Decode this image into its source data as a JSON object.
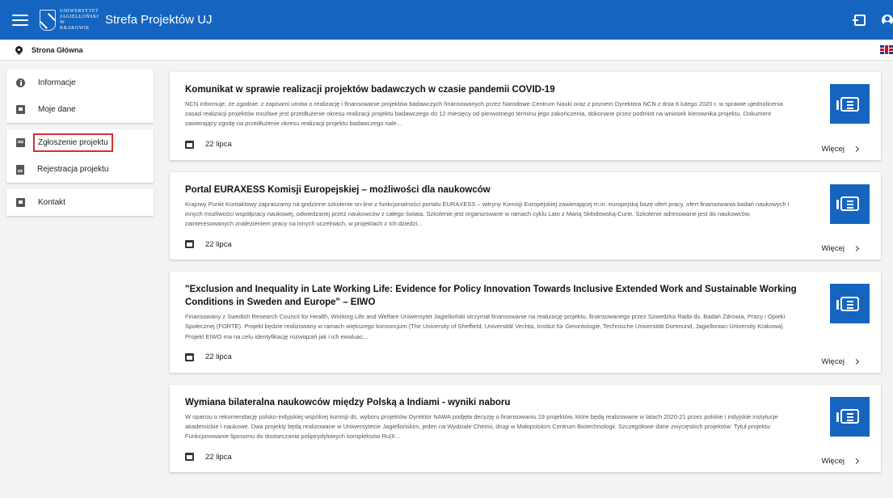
{
  "header": {
    "app_title": "Strefa Projektów UJ",
    "logo_text": "Uniwersytet Jagielloński w Krakowie",
    "brand_color": "#1565c0",
    "icons": [
      "menu-icon",
      "login-icon",
      "account-icon"
    ]
  },
  "breadcrumb": {
    "current": "Strona Główna",
    "language_flag": "uk-flag-icon"
  },
  "sidebar": {
    "groups": [
      [
        {
          "label": "Informacje",
          "icon": "info-icon"
        },
        {
          "label": "Moje dane",
          "icon": "id-card-icon"
        }
      ],
      [
        {
          "label": "Zgłoszenie projektu",
          "icon": "message-icon",
          "active": true
        },
        {
          "label": "Rejestracja projektu",
          "icon": "document-icon"
        }
      ],
      [
        {
          "label": "Kontakt",
          "icon": "contact-card-icon"
        }
      ]
    ]
  },
  "news": [
    {
      "title": "Komunikat w sprawie realizacji projektów badawczych w czasie pandemii COVID-19",
      "body": "NCN informuje, że zgodnie: z zapisami umów o realizację i finansowanie projektów badawczych finansowanych przez Narodowe Centrum Nauki oraz z pismem Dyrektora NCN z dnia 6 lutego 2020 r. w sprawie ujednolicenia zasad realizacji projektów możliwe jest przedłużenie okresu realizacji projektu badawczego do 12 miesięcy od pierwotnego terminu jego zakończenia, dokonane przez podmiot na wniosek kierownika projektu. Dokument zawierający zgodę na przedłużenie okresu realizacji projektu badawczego nale...",
      "date": "22 lipca",
      "more": "Więcej"
    },
    {
      "title": "Portal EURAXESS Komisji Europejskiej – możliwości dla naukowców",
      "body": "Krajowy Punkt Kontaktowy zapraszamy na godzinne szkolenie on-line z funkcjonalności portalu EURAXESS – witryny Komisji Europejskiej zawierającej m.in. europejską bazę ofert pracy, ofert finansowania badań naukowych i innych możliwości współpracy naukowej, odwiedzanej przez naukowców z całego świata. Szkolenie jest organizowane w ramach cyklu Lato z Marią Skłodowską-Curie. Szkolenie adresowane jest do naukowców, zainteresowanych znalezieniem pracy na innych uczelniach, w projektach z ich dziedzi...",
      "date": "22 lipca",
      "more": "Więcej"
    },
    {
      "title": "\"Exclusion and Inequality in Late Working Life: Evidence for Policy Innovation Towards Inclusive Extended Work and Sustainable Working Conditions in Sweden and Europe\" – EIWO",
      "body": "Finansowany z Swedish Research Council for Health, Working Life and Welfare Uniwersytet Jagielloński otrzymał finansowanie na realizację projektu, finansowanego przez Szwedzka Rada ds. Badań Zdrowia, Pracy i Opieki Społecznej (FORTE). Projekt będzie realizowany w ramach większego konsorcjum (The University of Sheffield, Universität Vechta, Institut für Gerontologie, Technische Universität Dortmund, Jagiellonian University Krakowa) Projekt EIWO ma na celu identyfikację rozwiązań jak i ich ewaluac...",
      "date": "22 lipca",
      "more": "Więcej"
    },
    {
      "title": "Wymiana bilateralna naukowców między Polską a Indiami - wyniki naboru",
      "body": "W oparciu o rekomendację polsko-indyjskiej wspólnej komisji ds. wyboru projektów Dyrektor NAWA podjęła decyzję o finansowaniu 19 projektów, które będą realizowane w latach 2020-21 przez polskie i indyjskie instytucje akademickie i naukowe. Dwa projekty będą realizowane w Uniwersytecie Jagiellońskim, jeden na Wydziale Chemii, drugi w Małopolskim Centrum Biotechnologii. Szczegółowe dane zwycięskich projektów: Tytuł projektu: Funkcjonowanie liposomu do dostarczania polipirydylowych kompleksów Ru(II...",
      "date": "22 lipca",
      "more": "Więcej"
    }
  ]
}
